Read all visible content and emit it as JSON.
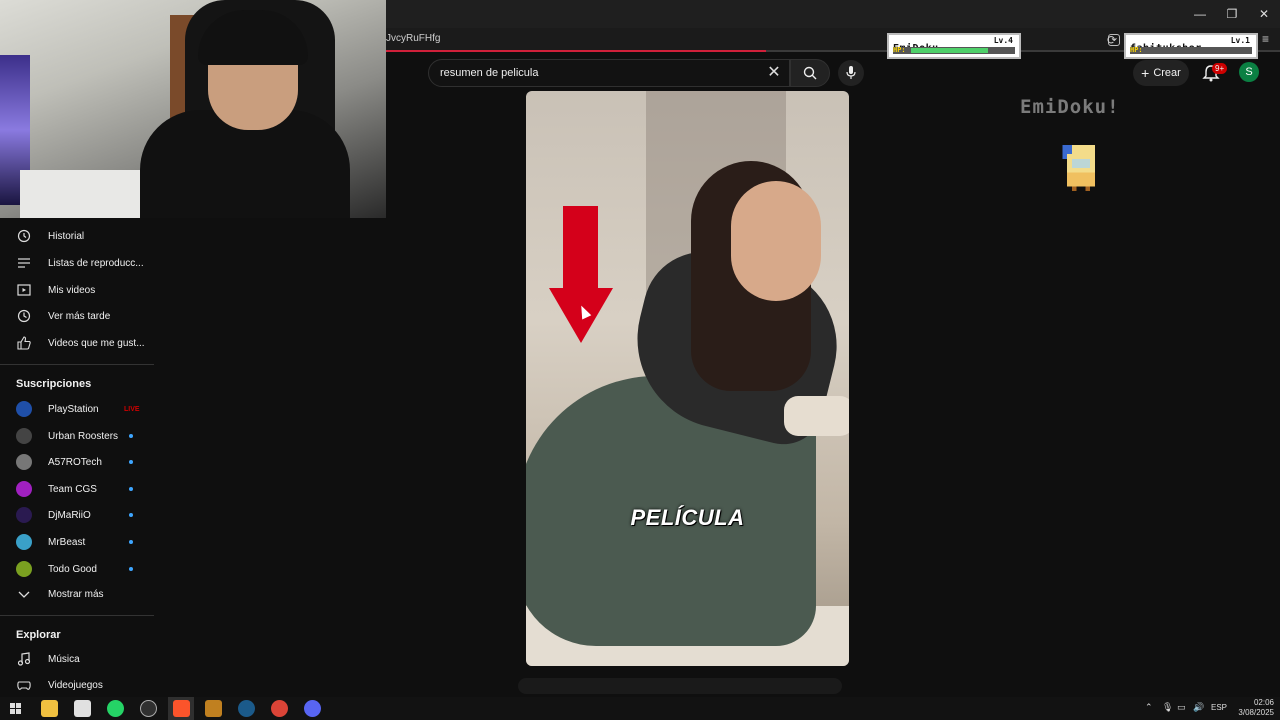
{
  "browser": {
    "url_fragment": "JvcyRuFHfg",
    "window_controls": [
      "—",
      "❐",
      "✕"
    ]
  },
  "search": {
    "query": "resumen de pelicula",
    "clear_symbol": "✕"
  },
  "header": {
    "create_label": "Crear",
    "notifications_badge": "9+",
    "avatar_letter": "S"
  },
  "overlay": {
    "player1": {
      "name": "EmiDoku",
      "level": "Lv.4",
      "hp_label": "HP:",
      "hp_fraction": 0.75
    },
    "player2": {
      "name": "fabitukcher",
      "level": "Lv.1",
      "hp_label": "HP:",
      "hp_fraction": 0.0
    },
    "title": "EmiDoku!"
  },
  "sidebar": {
    "you_items": [
      {
        "label": "Historial",
        "icon": "history-icon"
      },
      {
        "label": "Listas de reproducc...",
        "icon": "playlist-icon"
      },
      {
        "label": "Mis videos",
        "icon": "my-videos-icon"
      },
      {
        "label": "Ver más tarde",
        "icon": "watch-later-icon"
      },
      {
        "label": "Videos que me gust...",
        "icon": "like-icon"
      }
    ],
    "subscriptions_heading": "Suscripciones",
    "subscriptions": [
      {
        "label": "PlayStation",
        "color": "#1f4fa8",
        "live": "LIVE"
      },
      {
        "label": "Urban Roosters",
        "color": "#444444"
      },
      {
        "label": "A57ROTech",
        "color": "#777777"
      },
      {
        "label": "Team CGS",
        "color": "#a020c0"
      },
      {
        "label": "DjMaRiiO",
        "color": "#2a1a50"
      },
      {
        "label": "MrBeast",
        "color": "#3aa0c8"
      },
      {
        "label": "Todo Good",
        "color": "#7aa020"
      }
    ],
    "show_more": "Mostrar más",
    "explore_heading": "Explorar",
    "explore_items": [
      {
        "label": "Música",
        "icon": "music-icon"
      },
      {
        "label": "Videojuegos",
        "icon": "gaming-icon"
      }
    ]
  },
  "video": {
    "caption": "PELÍCULA"
  },
  "taskbar": {
    "lang": "ESP",
    "time": "02:06",
    "date": "3/08/2025"
  },
  "colors": {
    "accent_red": "#d4001a",
    "background": "#0f0f0f",
    "hp_green": "#4fd06a",
    "link_blue": "#3ea6ff"
  }
}
